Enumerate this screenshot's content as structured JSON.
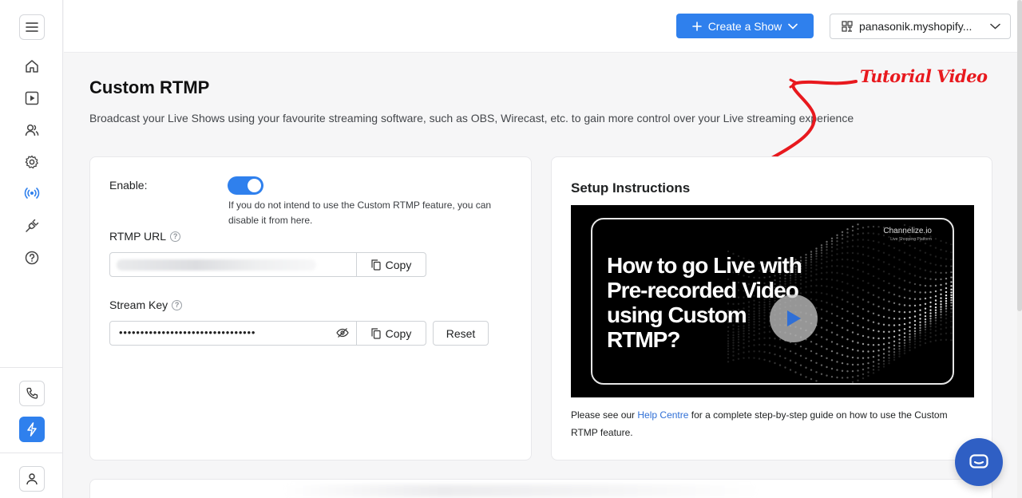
{
  "sidebar": {
    "menu_icon": "hamburger-icon",
    "items": [
      {
        "id": "home",
        "icon": "home-icon"
      },
      {
        "id": "shows",
        "icon": "play-square-icon"
      },
      {
        "id": "users",
        "icon": "users-icon"
      },
      {
        "id": "settings",
        "icon": "gear-icon"
      },
      {
        "id": "live",
        "icon": "broadcast-icon"
      },
      {
        "id": "integrations",
        "icon": "plug-icon"
      },
      {
        "id": "help",
        "icon": "question-icon"
      }
    ],
    "bottom": [
      {
        "id": "phone",
        "icon": "phone-icon"
      },
      {
        "id": "upgrade",
        "icon": "lightning-icon"
      },
      {
        "id": "account",
        "icon": "user-icon"
      }
    ]
  },
  "topbar": {
    "create_label": "Create a Show",
    "store_label": "panasonik.myshopify..."
  },
  "page": {
    "title": "Custom RTMP",
    "description": "Broadcast your Live Shows using your favourite streaming software, such as OBS, Wirecast, etc. to gain more control over your Live streaming experience",
    "annotation": "Tutorial Video"
  },
  "settings": {
    "enable_label": "Enable:",
    "enabled": true,
    "enable_hint": "If you do not intend to use the Custom RTMP feature, you can disable it from here.",
    "rtmp_url_label": "RTMP URL",
    "rtmp_url_value": "",
    "stream_key_label": "Stream Key",
    "stream_key_value": "••••••••••••••••••••••••••••••••",
    "copy_label": "Copy",
    "reset_label": "Reset"
  },
  "setup": {
    "title": "Setup Instructions",
    "video_title": "How to go Live with Pre-recorded Video using Custom RTMP?",
    "video_brand": "Channelize.io",
    "video_brand_sub": "Live Shopping Platform",
    "footer_prefix": "Please see our ",
    "footer_link": "Help Centre",
    "footer_suffix": " for a complete step-by-step guide on how to use the Custom RTMP feature."
  },
  "colors": {
    "accent": "#2f80ed",
    "annotation": "#e8191e",
    "chat": "#2f5fc4"
  }
}
